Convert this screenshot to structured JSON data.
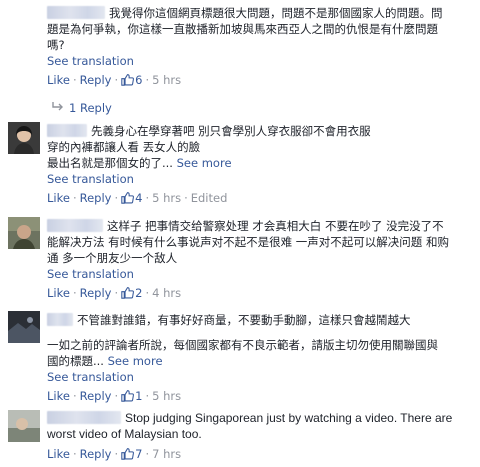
{
  "comments": [
    {
      "lines": [
        "我覺得你這個網頁標題很大問題，問題不是那個國家人的問題。問",
        "題是為何爭執，你這樣一直散播新加坡與馬來西亞人之間的仇恨是有什麼問題",
        "嗎?"
      ],
      "see_translation": "See translation",
      "like": "Like",
      "reply": "Reply",
      "likes": "6",
      "time": "5 hrs",
      "edited": "",
      "replies_label": "1 Reply"
    },
    {
      "lines": [
        "先義身心在學穿著吧 別只會學別人穿衣服卻不會用衣服",
        "穿的內褲都讓人看 丟女人的臉",
        "最出名就是那個女的了..."
      ],
      "see_more": "See more",
      "see_translation": "See translation",
      "like": "Like",
      "reply": "Reply",
      "likes": "4",
      "time": "5 hrs",
      "edited": "Edited"
    },
    {
      "lines": [
        "这样子 把事情交给警察处理 才会真相大白 不要在吵了 没完没了不",
        "能解决方法 有时候有什么事说声对不起不是很难 一声对不起可以解决问题 和购",
        "通 多一个朋友少一个敌人"
      ],
      "see_translation": "See translation",
      "like": "Like",
      "reply": "Reply",
      "likes": "2",
      "time": "4 hrs",
      "edited": ""
    },
    {
      "lines": [
        "不管誰對誰錯，有事好好商量，不要動手動腳，這樣只會越鬧越大",
        "",
        "一如之前的評論者所說，每個國家都有不良示範者，請版主切勿使用關聯國與",
        "國的標題..."
      ],
      "see_more": "See more",
      "see_translation": "See translation",
      "like": "Like",
      "reply": "Reply",
      "likes": "1",
      "time": "5 hrs",
      "edited": ""
    },
    {
      "lines": [
        "Stop judging Singaporean just by watching a video. There are",
        "worst video of Malaysian too."
      ],
      "like": "Like",
      "reply": "Reply",
      "likes": "7",
      "time": "7 hrs",
      "edited": ""
    }
  ],
  "colors": {
    "link": "#365899",
    "meta": "#90949c",
    "text": "#1d2129",
    "blur_name": "#d3d9e8"
  },
  "icons": {
    "like": "thumbs-up-icon",
    "reply": "reply-arrow-icon"
  }
}
